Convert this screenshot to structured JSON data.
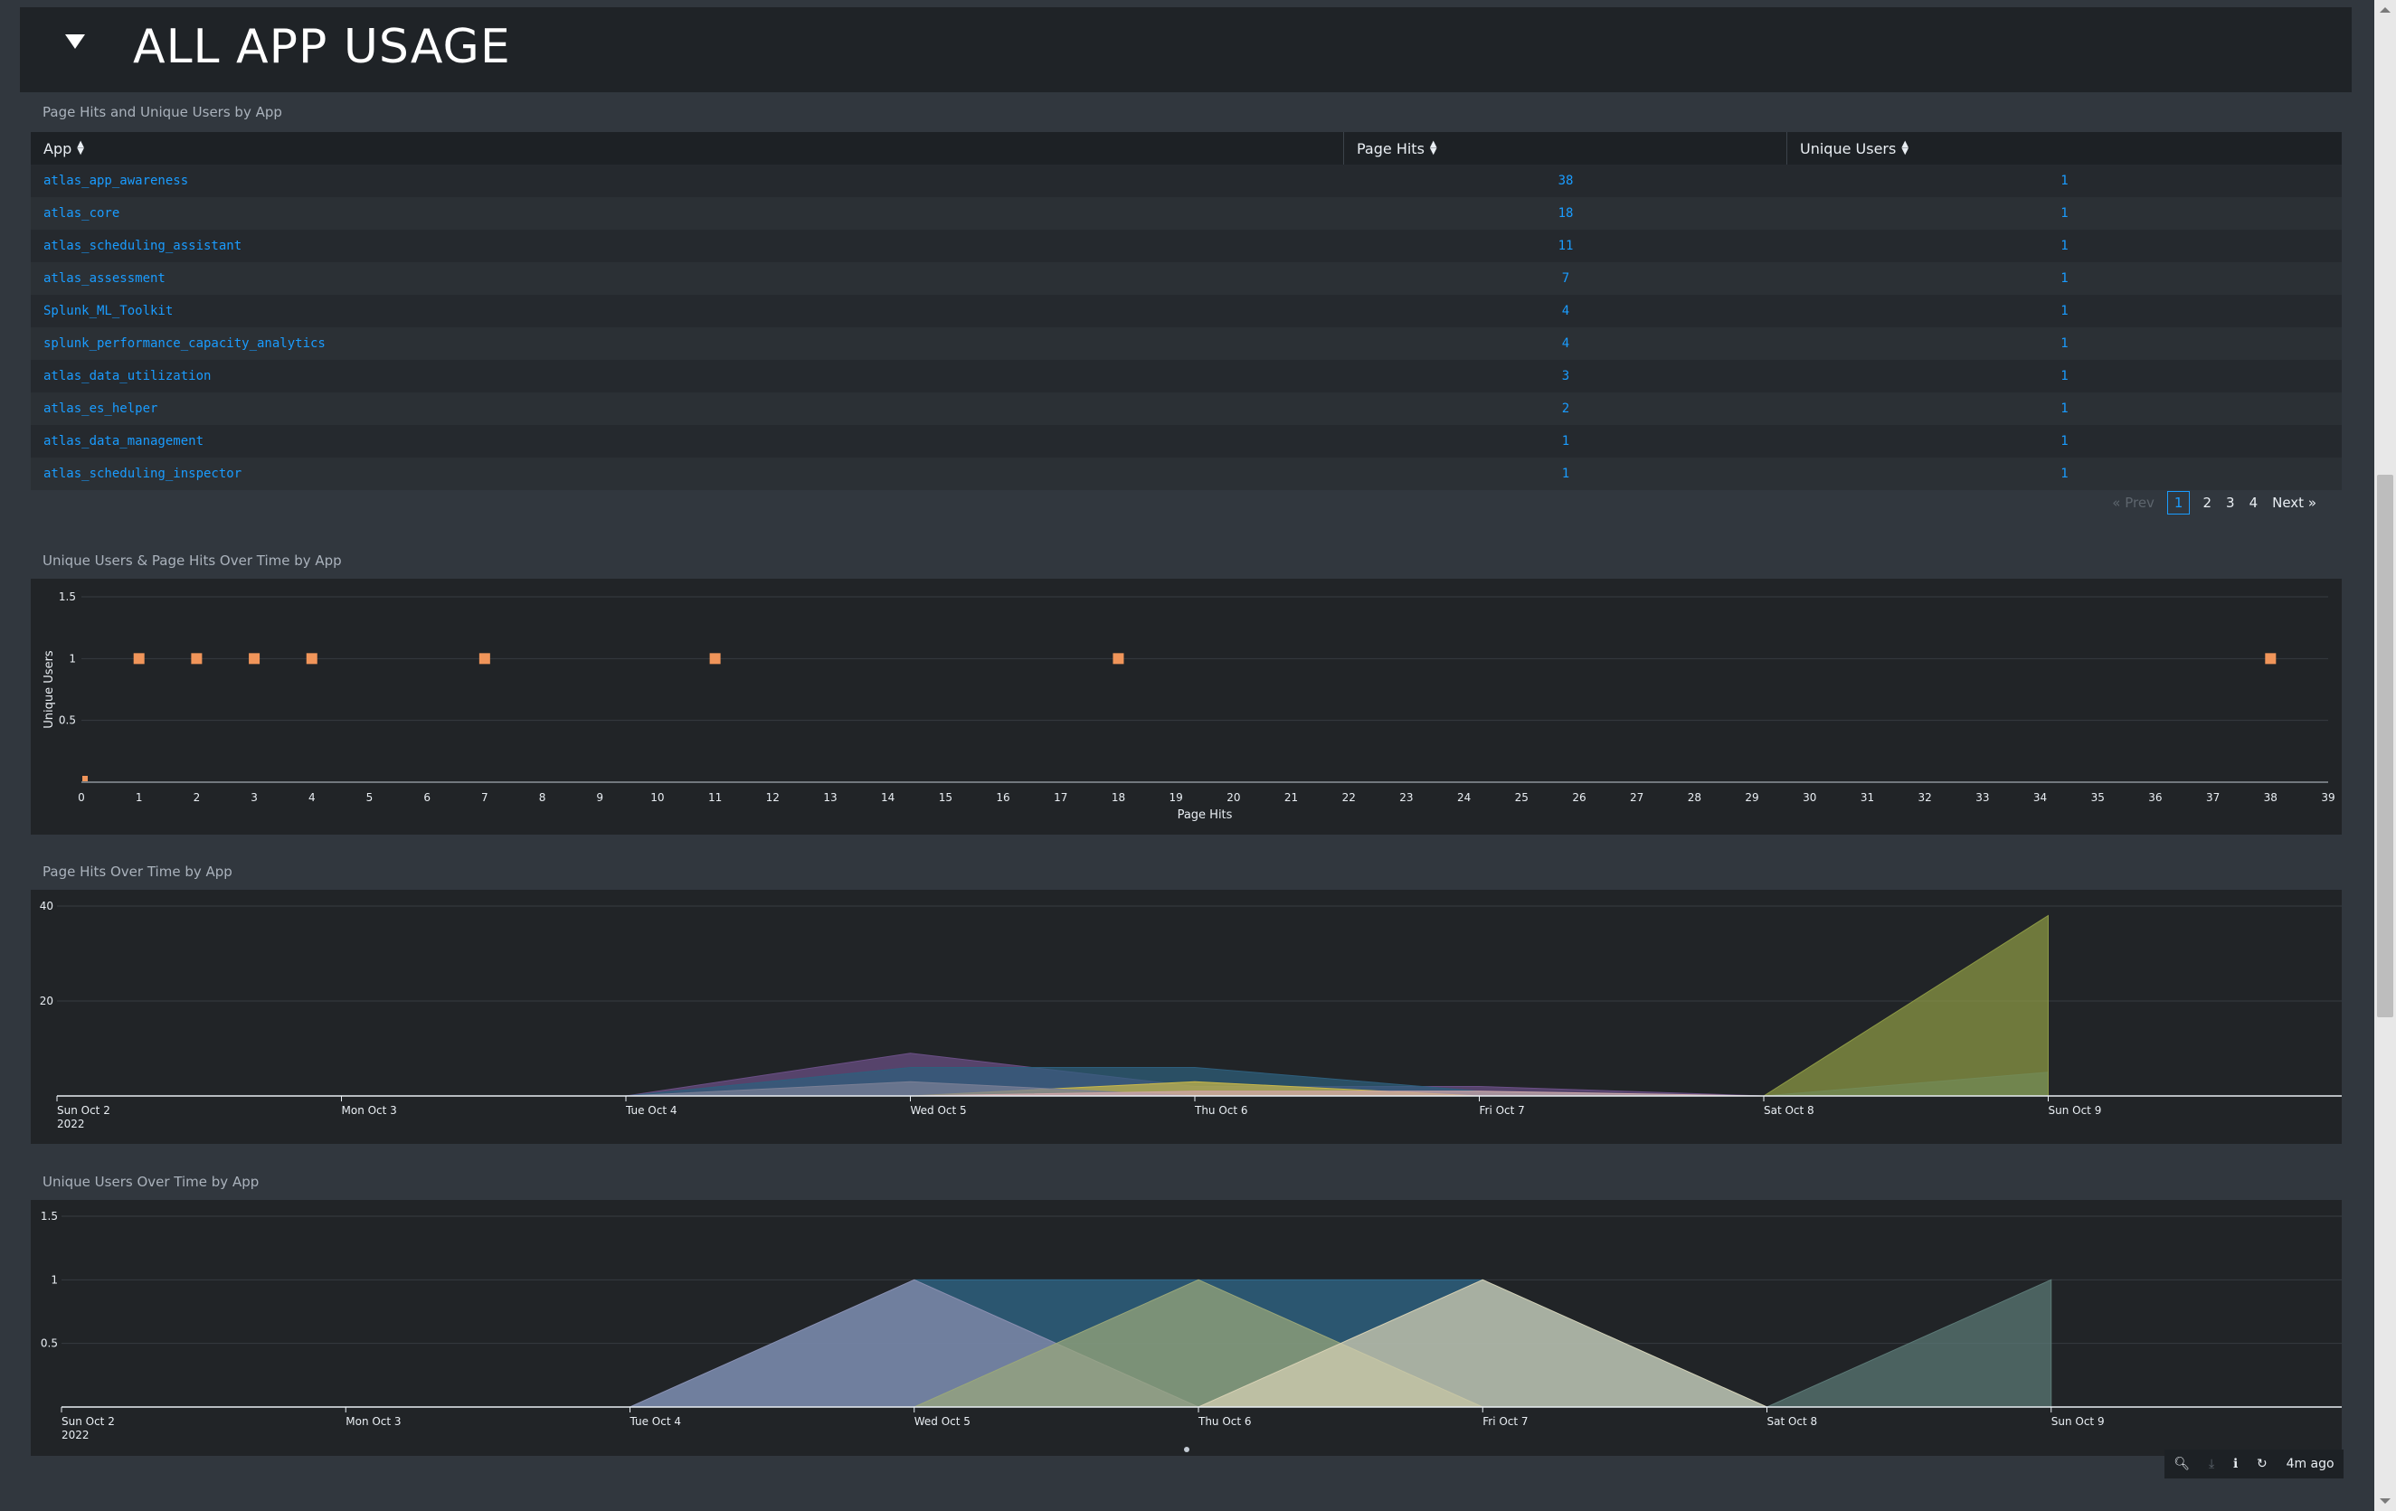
{
  "header": {
    "title": "ALL APP USAGE"
  },
  "table_panel": {
    "title": "Page Hits and Unique Users by App",
    "columns": [
      "App",
      "Page Hits",
      "Unique Users"
    ],
    "rows": [
      {
        "app": "atlas_app_awareness",
        "hits": "38",
        "users": "1"
      },
      {
        "app": "atlas_core",
        "hits": "18",
        "users": "1"
      },
      {
        "app": "atlas_scheduling_assistant",
        "hits": "11",
        "users": "1"
      },
      {
        "app": "atlas_assessment",
        "hits": "7",
        "users": "1"
      },
      {
        "app": "Splunk_ML_Toolkit",
        "hits": "4",
        "users": "1"
      },
      {
        "app": "splunk_performance_capacity_analytics",
        "hits": "4",
        "users": "1"
      },
      {
        "app": "atlas_data_utilization",
        "hits": "3",
        "users": "1"
      },
      {
        "app": "atlas_es_helper",
        "hits": "2",
        "users": "1"
      },
      {
        "app": "atlas_data_management",
        "hits": "1",
        "users": "1"
      },
      {
        "app": "atlas_scheduling_inspector",
        "hits": "1",
        "users": "1"
      }
    ],
    "pager": {
      "prev": "« Prev",
      "pages": [
        "1",
        "2",
        "3",
        "4"
      ],
      "current": "1",
      "next": "Next »"
    }
  },
  "chart_titles": {
    "scatter": "Unique Users & Page Hits Over Time by App",
    "hits": "Page Hits Over Time by App",
    "users": "Unique Users Over Time by App"
  },
  "footer": {
    "time": "4m ago"
  },
  "chart_data": [
    {
      "type": "scatter",
      "xlabel": "Page Hits",
      "ylabel": "Unique Users",
      "xlim": [
        0,
        39
      ],
      "ylim": [
        0,
        1.5
      ],
      "yticks": [
        "0.5",
        "1",
        "1.5"
      ],
      "color": "#f0955a",
      "points": [
        [
          0,
          0
        ],
        [
          1,
          1
        ],
        [
          2,
          1
        ],
        [
          3,
          1
        ],
        [
          4,
          1
        ],
        [
          7,
          1
        ],
        [
          11,
          1
        ],
        [
          18,
          1
        ],
        [
          38,
          1
        ]
      ]
    },
    {
      "type": "area",
      "x": [
        "Sun Oct 2",
        "Mon Oct 3",
        "Tue Oct 4",
        "Wed Oct 5",
        "Thu Oct 6",
        "Fri Oct 7",
        "Sat Oct 8",
        "Sun Oct 9"
      ],
      "year_label": "2022",
      "ylim": [
        0,
        40
      ],
      "yticks": [
        "20",
        "40"
      ],
      "series": [
        {
          "color": "#6b4f86",
          "values": [
            0,
            0,
            0,
            9,
            2,
            2,
            0,
            0
          ]
        },
        {
          "color": "#2e5f7d",
          "values": [
            0,
            0,
            0,
            6,
            6,
            1,
            0,
            5
          ]
        },
        {
          "color": "#c9b84a",
          "values": [
            0,
            0,
            0,
            0,
            3,
            0,
            0,
            0
          ]
        },
        {
          "color": "#8e9a45",
          "values": [
            0,
            0,
            0,
            0,
            0,
            0,
            0,
            38
          ]
        },
        {
          "color": "#7a7f95",
          "values": [
            0,
            0,
            0,
            3,
            0,
            0,
            0,
            0
          ]
        },
        {
          "color": "#cfa6a9",
          "values": [
            0,
            0,
            0,
            0,
            1,
            1,
            0,
            0
          ]
        }
      ]
    },
    {
      "type": "area",
      "x": [
        "Sun Oct 2",
        "Mon Oct 3",
        "Tue Oct 4",
        "Wed Oct 5",
        "Thu Oct 6",
        "Fri Oct 7",
        "Sat Oct 8",
        "Sun Oct 9"
      ],
      "year_label": "2022",
      "ylim": [
        0,
        1.5
      ],
      "yticks": [
        "0.5",
        "1",
        "1.5"
      ],
      "series": [
        {
          "color": "#2f6a8d",
          "values": [
            0,
            0,
            0,
            1,
            1,
            1,
            0,
            0
          ]
        },
        {
          "color": "#8b8fb0",
          "values": [
            0,
            0,
            0,
            1,
            0,
            0,
            0,
            0
          ]
        },
        {
          "color": "#9aa77a",
          "values": [
            0,
            0,
            0,
            0,
            1,
            0,
            0,
            0
          ]
        },
        {
          "color": "#d7d1b4",
          "values": [
            0,
            0,
            0,
            0,
            0,
            1,
            0,
            0
          ]
        },
        {
          "color": "#5c7a77",
          "values": [
            0,
            0,
            0,
            0,
            0,
            0,
            0,
            1
          ]
        }
      ]
    }
  ]
}
